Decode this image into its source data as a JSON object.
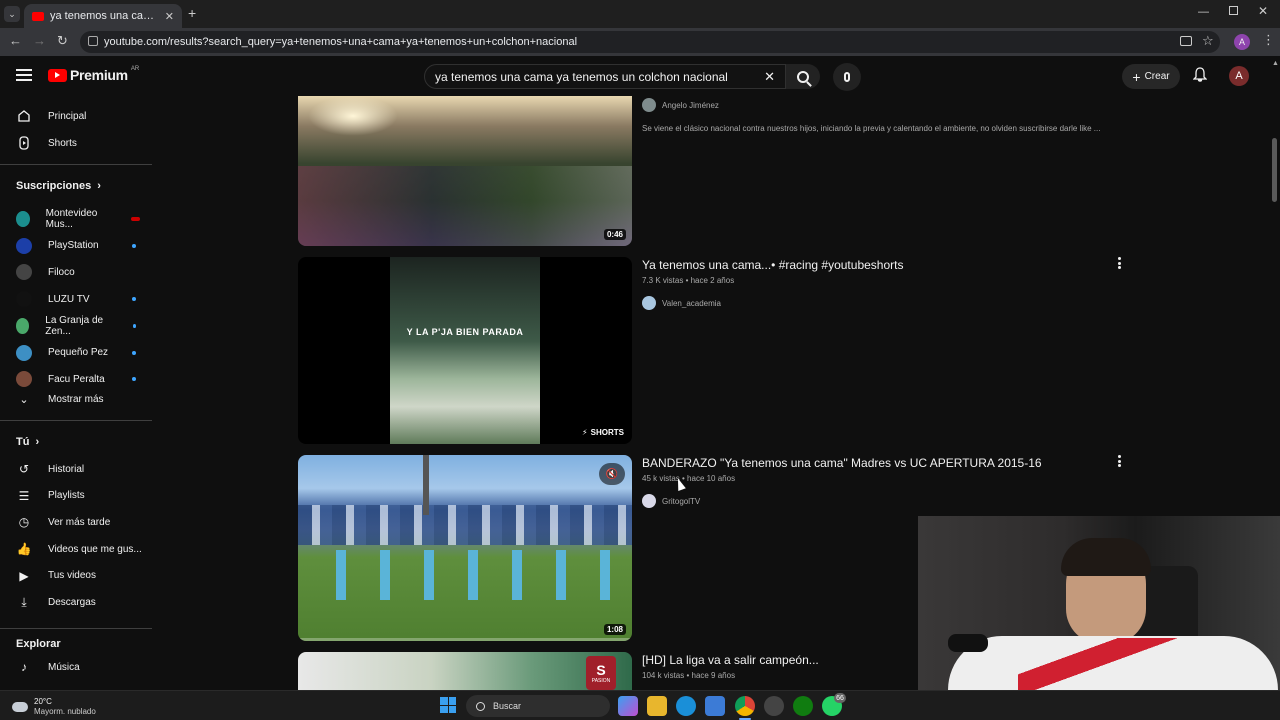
{
  "browser": {
    "tab_title": "ya tenemos una cama ya tenemos",
    "url": "youtube.com/results?search_query=ya+tenemos+una+cama+ya+tenemos+un+colchon+nacional",
    "profile_initial": "A"
  },
  "header": {
    "logo_text": "Premium",
    "logo_region": "AR",
    "search_value": "ya tenemos una cama ya tenemos un colchon nacional",
    "create_label": "Crear",
    "avatar_initial": "A"
  },
  "sidebar": {
    "main": [
      {
        "label": "Principal",
        "icon": "home-icon"
      },
      {
        "label": "Shorts",
        "icon": "shorts-icon"
      }
    ],
    "subscriptions_heading": "Suscripciones",
    "subscriptions": [
      {
        "label": "Montevideo Mus...",
        "color": "#1b8e8e",
        "badge": "live"
      },
      {
        "label": "PlayStation",
        "color": "#1c3fa8",
        "badge": "dot"
      },
      {
        "label": "Filoco",
        "color": "#444444",
        "badge": ""
      },
      {
        "label": "LUZU TV",
        "color": "#111111",
        "badge": "dot"
      },
      {
        "label": "La Granja de Zen...",
        "color": "#4aa86a",
        "badge": "dot"
      },
      {
        "label": "Pequeño Pez",
        "color": "#3d8fc4",
        "badge": "dot"
      },
      {
        "label": "Facu Peralta",
        "color": "#7a4a3a",
        "badge": "dot"
      }
    ],
    "show_more": "Mostrar más",
    "you_heading": "Tú",
    "you_items": [
      {
        "label": "Historial",
        "icon": "history-icon"
      },
      {
        "label": "Playlists",
        "icon": "playlists-icon"
      },
      {
        "label": "Ver más tarde",
        "icon": "watch-later-icon"
      },
      {
        "label": "Videos que me gus...",
        "icon": "like-icon"
      },
      {
        "label": "Tus videos",
        "icon": "your-videos-icon"
      },
      {
        "label": "Descargas",
        "icon": "download-icon"
      }
    ],
    "explore_heading": "Explorar",
    "explore_items": [
      {
        "label": "Música",
        "icon": "music-icon"
      }
    ]
  },
  "results": [
    {
      "title": "",
      "meta": "",
      "channel": "Angelo Jiménez",
      "description": "Se viene el clásico nacional contra nuestros hijos, iniciando la previa y calentando el ambiente, no olviden suscribirse darle like ...",
      "duration": "0:46"
    },
    {
      "title": "Ya tenemos una cama...• #racing #youtubeshorts",
      "meta": "7.3 K vistas • hace 2 años",
      "channel": "Valen_academia",
      "thumb_caption": "Y LA P'JA BIEN PARADA",
      "shorts_label": "SHORTS"
    },
    {
      "title": "BANDERAZO \"Ya tenemos una cama\" Madres vs UC APERTURA 2015-16",
      "meta": "45 k vistas • hace 10 años",
      "channel": "GritogolTV",
      "duration": "1:08"
    },
    {
      "title": "[HD] La liga va a salir campeón...",
      "meta": "104 k vistas • hace 9 años",
      "thumb_badge": "PASION"
    }
  ],
  "taskbar": {
    "weather_temp": "20°C",
    "weather_desc": "Mayorm. nublado",
    "search_label": "Buscar",
    "whatsapp_badge": "66"
  }
}
